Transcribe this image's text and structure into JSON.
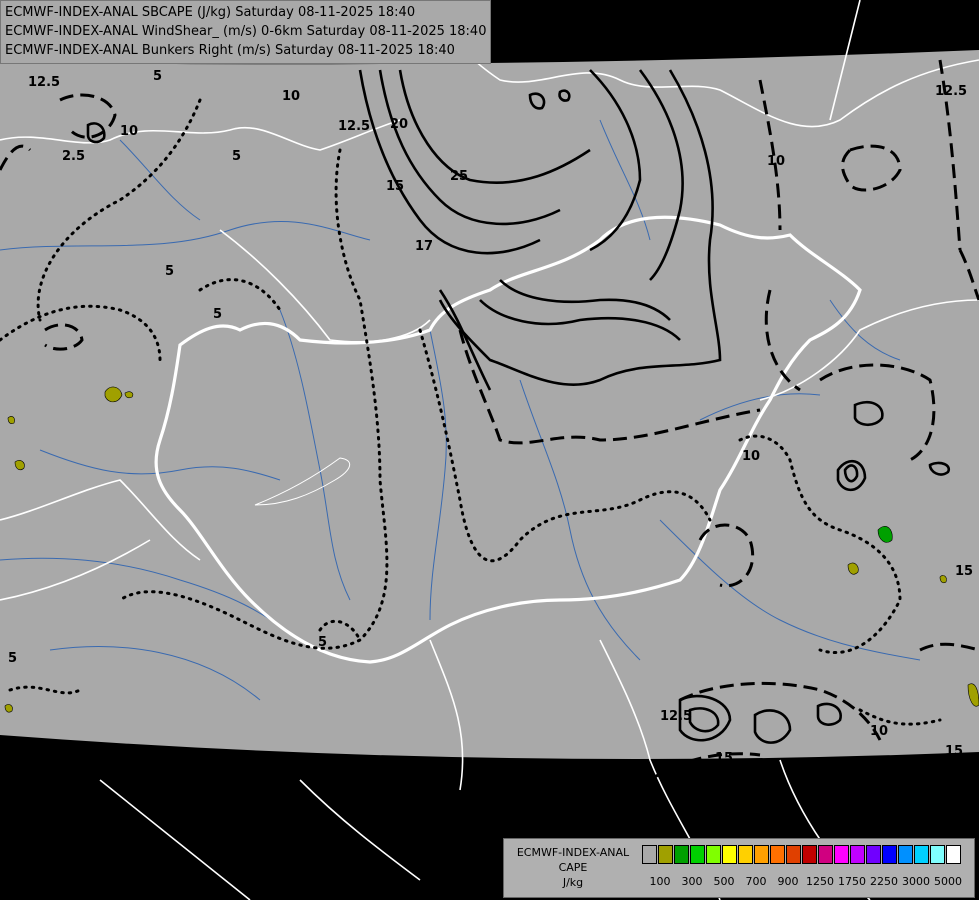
{
  "titles": [
    "ECMWF-INDEX-ANAL SBCAPE (J/kg) Saturday 08-11-2025 18:40",
    "ECMWF-INDEX-ANAL WindShear_ (m/s) 0-6km Saturday 08-11-2025 18:40",
    "ECMWF-INDEX-ANAL Bunkers Right (m/s) Saturday 08-11-2025 18:40"
  ],
  "legend": {
    "line1": "ECMWF-INDEX-ANAL",
    "line2": "CAPE",
    "line3": "J/kg",
    "colors": [
      "#a9a9a9",
      "#a0a000",
      "#00a000",
      "#00d000",
      "#80ff00",
      "#ffff00",
      "#ffd000",
      "#ffa000",
      "#ff7000",
      "#e04000",
      "#c00000",
      "#d00080",
      "#ff00ff",
      "#c000ff",
      "#7000ff",
      "#0000ff",
      "#0090ff",
      "#00d0ff",
      "#80ffff",
      "#ffffff"
    ],
    "ticks": [
      "100",
      "300",
      "500",
      "700",
      "900",
      "1250",
      "1750",
      "2250",
      "3000",
      "5000"
    ]
  },
  "contour_labels": [
    "12.5",
    "5",
    "10",
    "12.5",
    "2.5",
    "20",
    "25",
    "15",
    "17",
    "5",
    "5",
    "5",
    "10",
    "12.5",
    "10",
    "10",
    "15",
    "5",
    "12.5",
    "15",
    "10",
    "5",
    "15"
  ],
  "colors": {
    "map_fill": "#a9a9a9",
    "outside": "#000000",
    "border": "#ffffff",
    "river": "#3a6ab0",
    "cape_low": "#a0a000"
  }
}
